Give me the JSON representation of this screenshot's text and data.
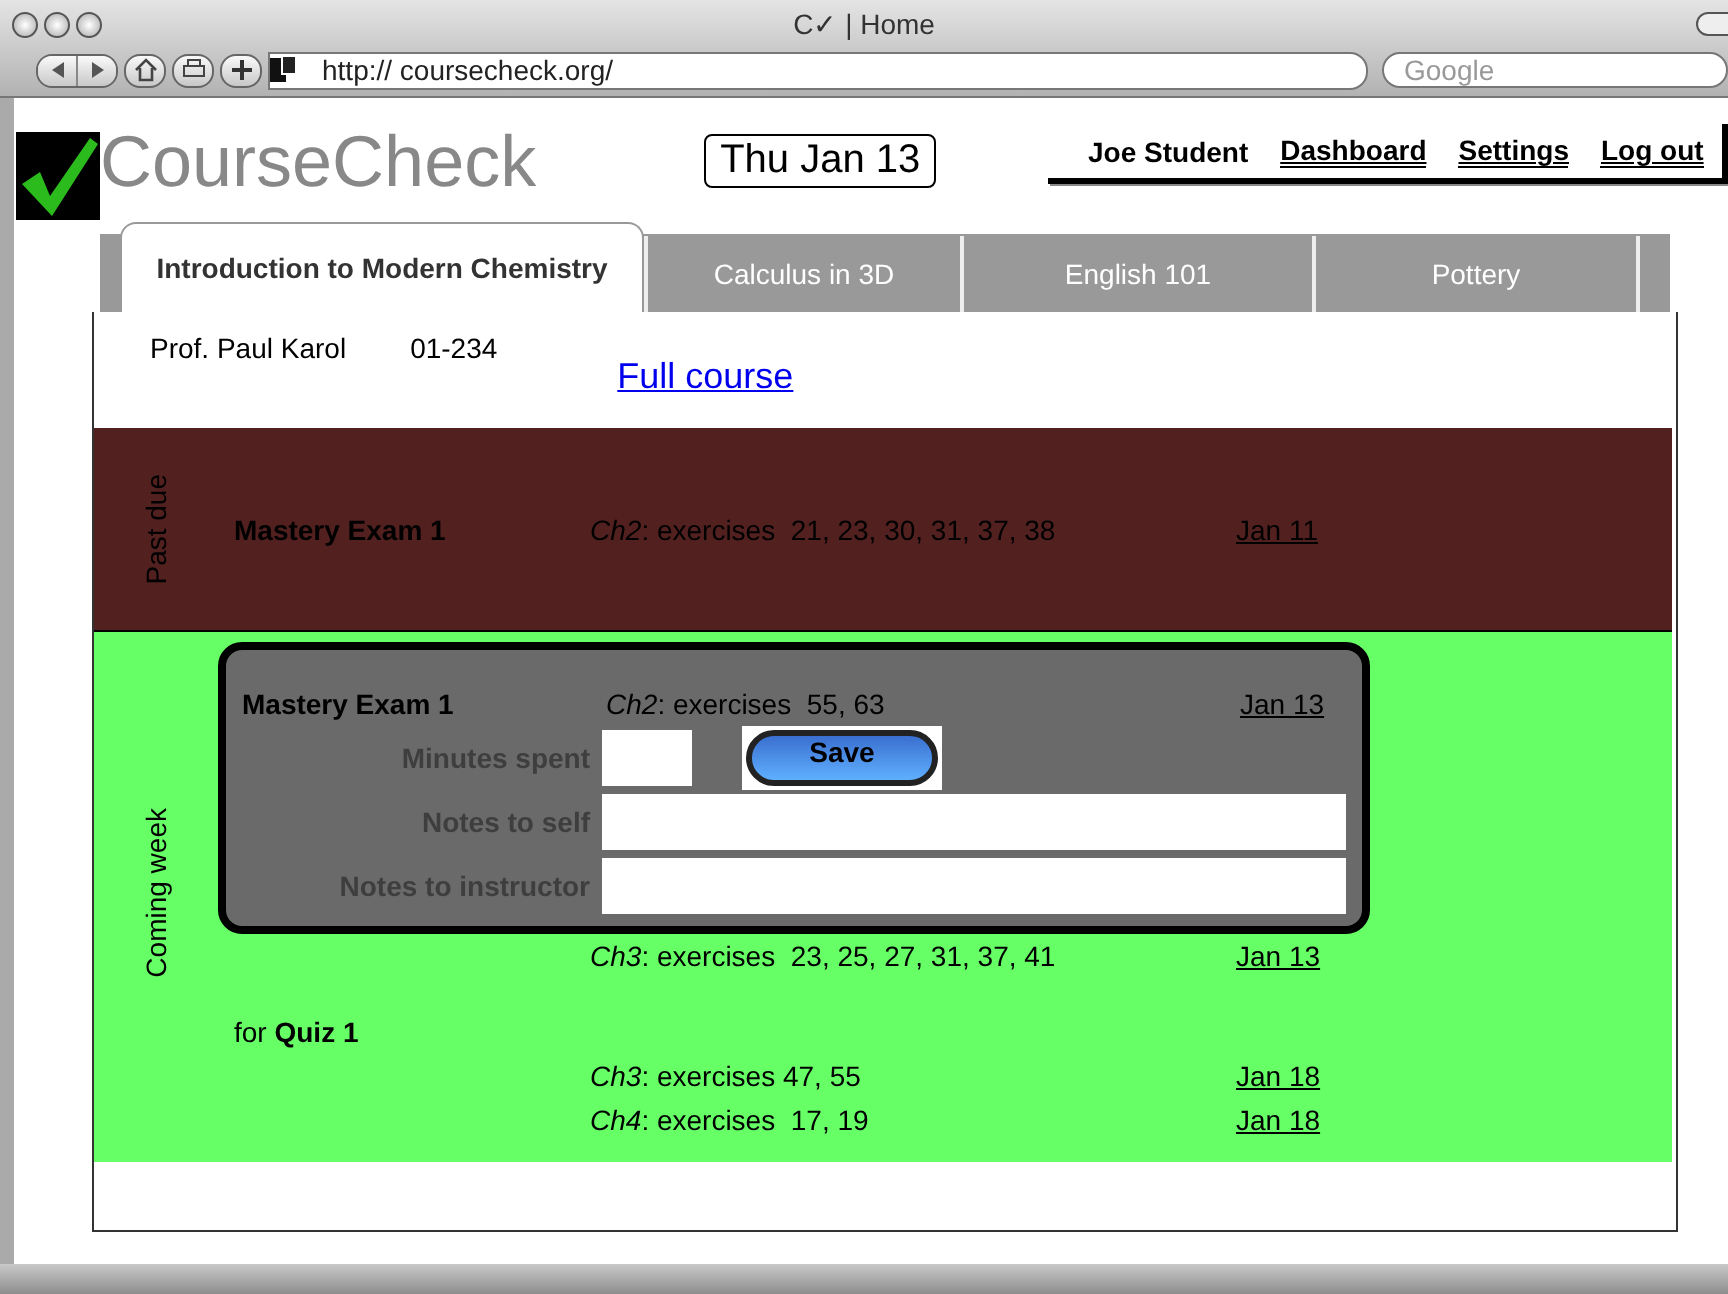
{
  "window": {
    "title": "C✓ | Home",
    "url": "http:// coursecheck.org/",
    "search": {
      "placeholder": "Google"
    }
  },
  "header": {
    "logo": "CourseCheck",
    "date": "Thu Jan 13",
    "user": "Joe Student",
    "links": [
      "Dashboard",
      "Settings",
      "Log out"
    ]
  },
  "tabs": [
    {
      "label": "Introduction to Modern Chemistry",
      "selected": true
    },
    {
      "label": "Calculus in 3D",
      "selected": false
    },
    {
      "label": "English 101",
      "selected": false
    },
    {
      "label": "Pottery",
      "selected": false
    }
  ],
  "course": {
    "professor": "Prof. Paul Karol",
    "code": "01-234",
    "link": "Full course"
  },
  "sections": [
    {
      "label": "Past due",
      "color": "#532020",
      "groups": [
        {
          "title": "Mastery Exam 1",
          "kind": "inline",
          "expanded": false,
          "assignments": [
            {
              "text": "*Ch2*: exercises  21, 23, 30, 31, 37, 38",
              "due": "Jan 11"
            }
          ]
        }
      ]
    },
    {
      "label": "Coming week",
      "color": "#66ff66",
      "groups": [
        {
          "title": "Mastery Exam 1",
          "kind": "inline",
          "expanded": true,
          "assignments": [
            {
              "text": "*Ch2*: exercises  55, 63",
              "due": "Jan 13"
            },
            {
              "text": "*Ch3*: exercises  23, 25, 27, 31, 37, 41",
              "due": "Jan 13"
            }
          ],
          "form": {
            "fields": [
              {
                "label": "Minutes spent",
                "kind": "short"
              },
              {
                "label": "Notes to self",
                "kind": "long"
              },
              {
                "label": "Notes to instructor",
                "kind": "long"
              }
            ],
            "button": "Save"
          }
        },
        {
          "title": "for **Quiz 1**",
          "kind": "heading",
          "expanded": false,
          "assignments": [
            {
              "text": "*Ch3*: exercises 47, 55",
              "due": "Jan 18"
            },
            {
              "text": "*Ch4*: exercises  17, 19",
              "due": "Jan 18"
            }
          ]
        }
      ]
    }
  ]
}
